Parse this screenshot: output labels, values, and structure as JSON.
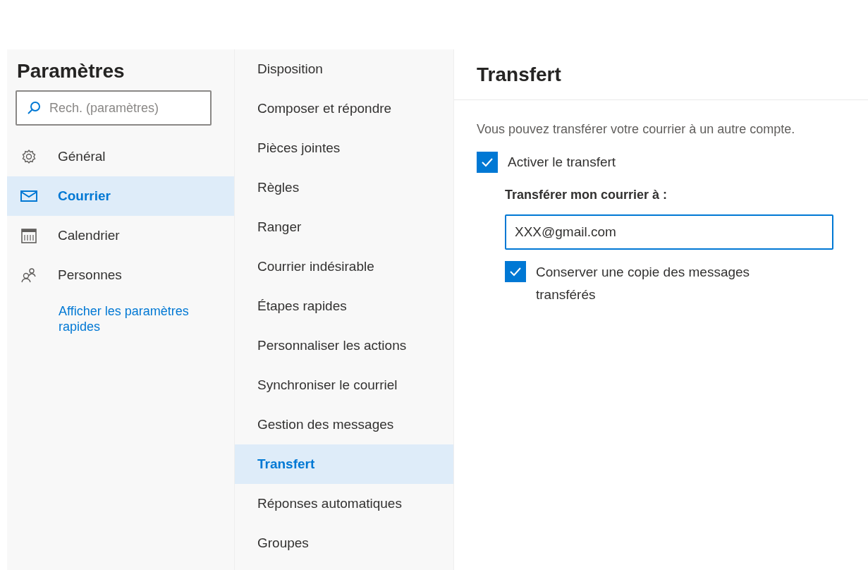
{
  "sidebar": {
    "title": "Paramètres",
    "search": {
      "placeholder": "Rech. (paramètres)"
    },
    "items": [
      {
        "label": "Général",
        "selected": false
      },
      {
        "label": "Courrier",
        "selected": true
      },
      {
        "label": "Calendrier",
        "selected": false
      },
      {
        "label": "Personnes",
        "selected": false
      }
    ],
    "link": "Afficher les paramètres rapides"
  },
  "categories": [
    {
      "label": "Disposition",
      "selected": false
    },
    {
      "label": "Composer et répondre",
      "selected": false
    },
    {
      "label": "Pièces jointes",
      "selected": false
    },
    {
      "label": "Règles",
      "selected": false
    },
    {
      "label": "Ranger",
      "selected": false
    },
    {
      "label": "Courrier indésirable",
      "selected": false
    },
    {
      "label": "Étapes rapides",
      "selected": false
    },
    {
      "label": "Personnaliser les actions",
      "selected": false
    },
    {
      "label": "Synchroniser le courriel",
      "selected": false
    },
    {
      "label": "Gestion des messages",
      "selected": false
    },
    {
      "label": "Transfert",
      "selected": true
    },
    {
      "label": "Réponses automatiques",
      "selected": false
    },
    {
      "label": "Groupes",
      "selected": false
    }
  ],
  "content": {
    "title": "Transfert",
    "description": "Vous pouvez transférer votre courrier à un autre compte.",
    "enable": {
      "label": "Activer le transfert",
      "checked": true
    },
    "field_label": "Transférer mon courrier à :",
    "field_value": "XXX@gmail.com",
    "keep_copy": {
      "label": "Conserver une copie des messages transférés",
      "checked": true
    }
  }
}
